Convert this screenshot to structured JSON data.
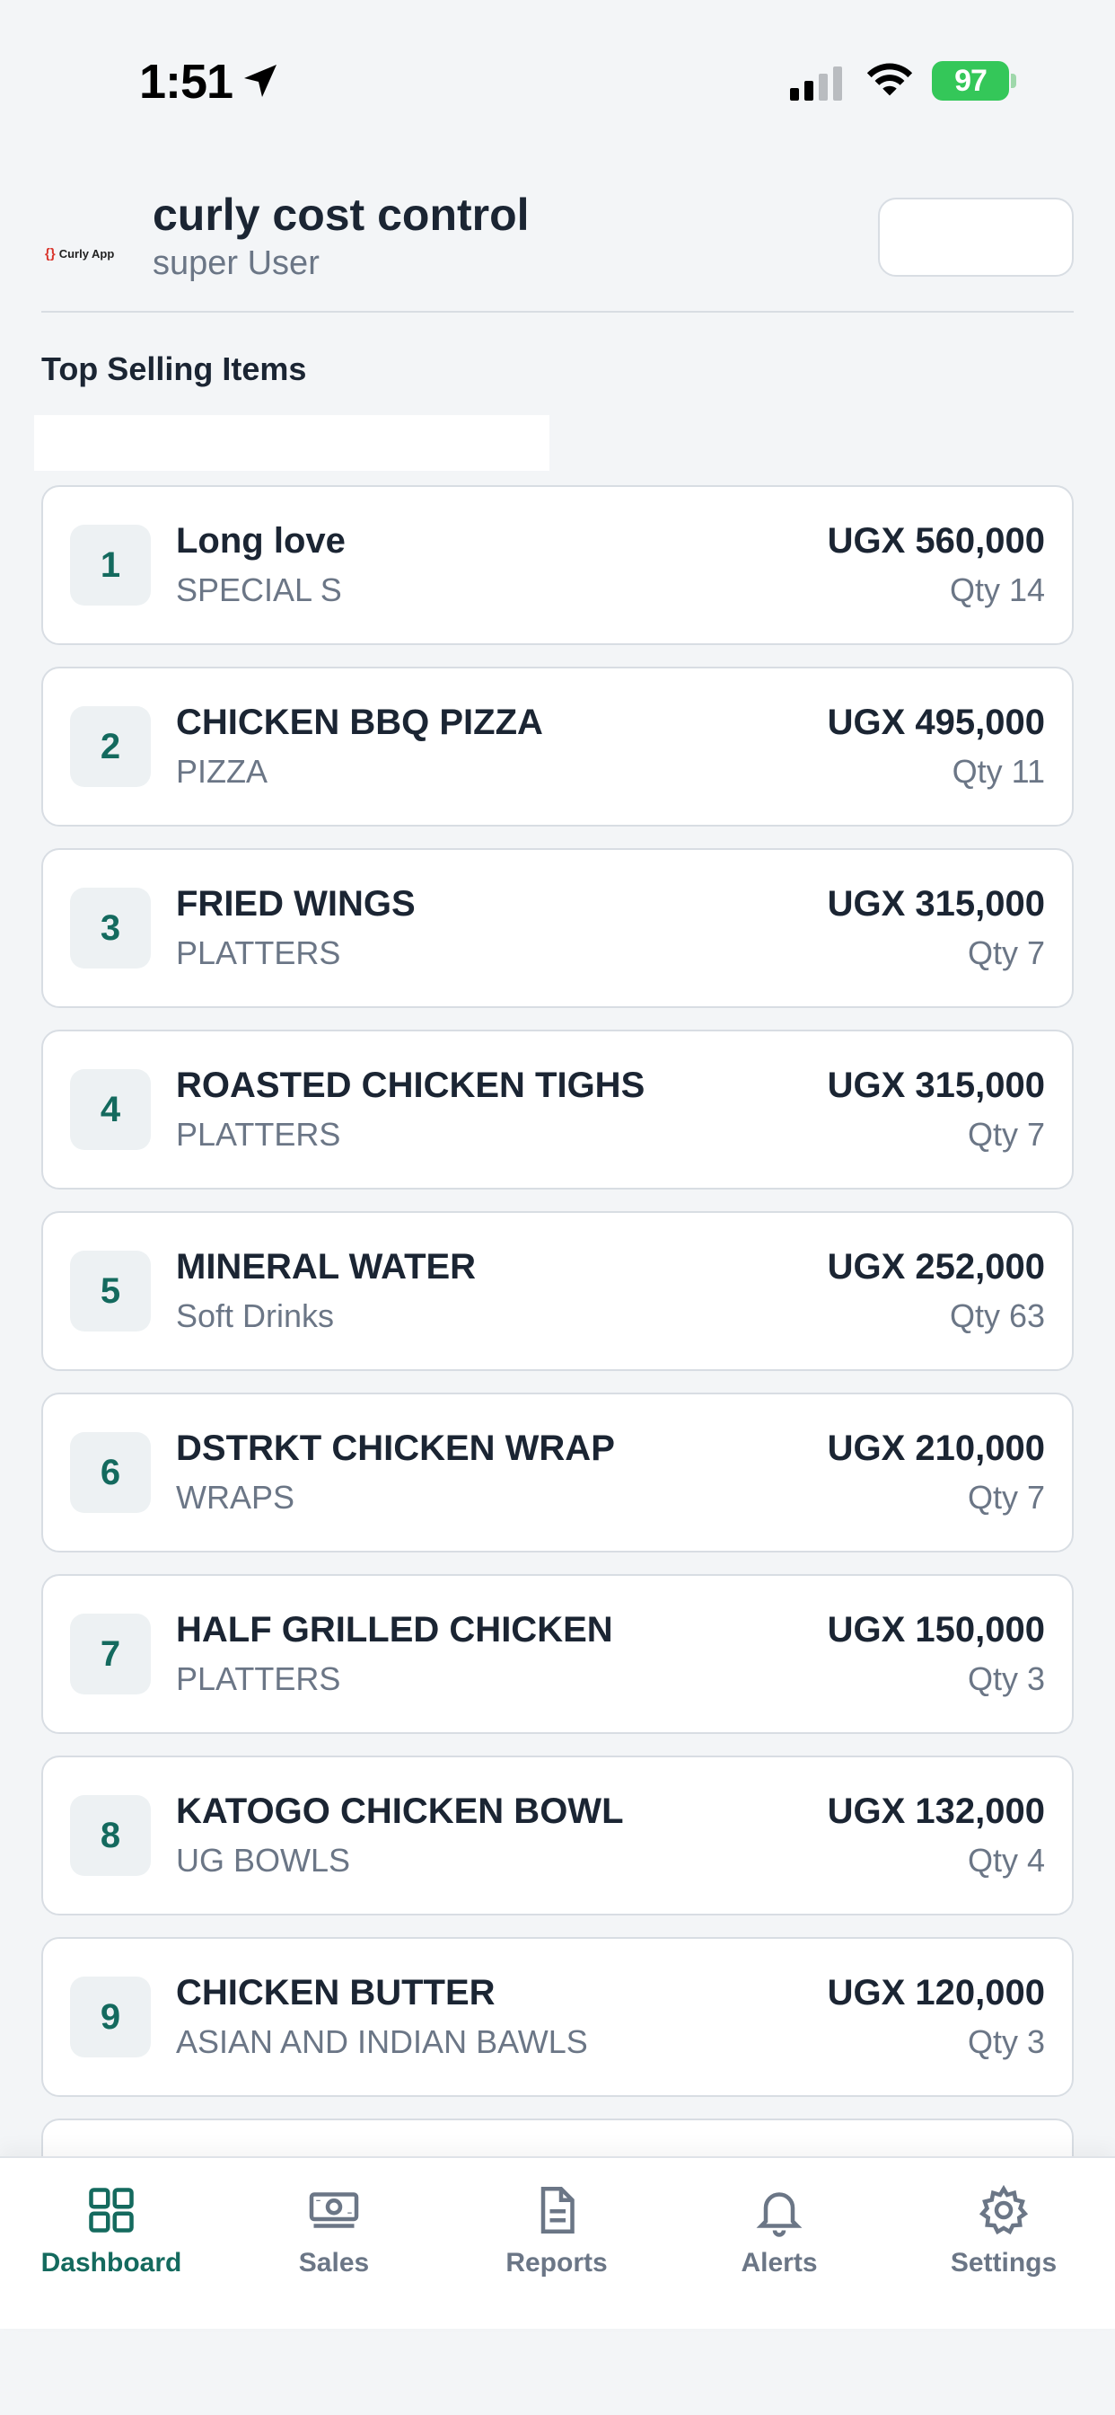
{
  "status_bar": {
    "time": "1:51",
    "battery": "97"
  },
  "header": {
    "logo_text": "Curly App",
    "logo_braces": "{}",
    "title": "curly cost control",
    "role": "super User"
  },
  "section_title": "Top Selling Items",
  "items": [
    {
      "rank": "1",
      "name": "Long love",
      "category": "SPECIAL S",
      "amount": "UGX 560,000",
      "qty": "Qty 14"
    },
    {
      "rank": "2",
      "name": "CHICKEN BBQ PIZZA",
      "category": "PIZZA",
      "amount": "UGX 495,000",
      "qty": "Qty 11"
    },
    {
      "rank": "3",
      "name": "FRIED WINGS",
      "category": "PLATTERS",
      "amount": "UGX 315,000",
      "qty": "Qty 7"
    },
    {
      "rank": "4",
      "name": "ROASTED CHICKEN TIGHS",
      "category": "PLATTERS",
      "amount": "UGX 315,000",
      "qty": "Qty 7"
    },
    {
      "rank": "5",
      "name": "MINERAL WATER",
      "category": "Soft Drinks",
      "amount": "UGX 252,000",
      "qty": "Qty 63"
    },
    {
      "rank": "6",
      "name": "DSTRKT CHICKEN WRAP",
      "category": "WRAPS",
      "amount": "UGX 210,000",
      "qty": "Qty 7"
    },
    {
      "rank": "7",
      "name": "HALF GRILLED CHICKEN",
      "category": "PLATTERS",
      "amount": "UGX 150,000",
      "qty": "Qty 3"
    },
    {
      "rank": "8",
      "name": "KATOGO CHICKEN BOWL",
      "category": "UG BOWLS",
      "amount": "UGX 132,000",
      "qty": "Qty 4"
    },
    {
      "rank": "9",
      "name": "CHICKEN BUTTER",
      "category": "ASIAN AND INDIAN BAWLS",
      "amount": "UGX 120,000",
      "qty": "Qty 3"
    }
  ],
  "nav": {
    "dashboard": "Dashboard",
    "sales": "Sales",
    "reports": "Reports",
    "alerts": "Alerts",
    "settings": "Settings",
    "active": "dashboard"
  },
  "colors": {
    "accent": "#146a5e",
    "muted": "#6b7686",
    "battery": "#34c759"
  }
}
